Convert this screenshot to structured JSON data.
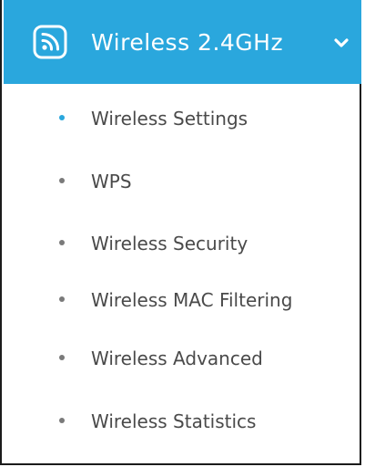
{
  "colors": {
    "accent": "#2aa7dd",
    "header_text": "#ffffff",
    "item_text": "#4a4a4a",
    "bullet": "#7a7a7a"
  },
  "menu": {
    "header": {
      "icon": "wireless-icon",
      "title": "Wireless 2.4GHz",
      "expand_icon": "chevron-down-icon"
    },
    "items": [
      {
        "label": "Wireless Settings",
        "active": true
      },
      {
        "label": "WPS",
        "active": false
      },
      {
        "label": "Wireless Security",
        "active": false
      },
      {
        "label": "Wireless MAC Filtering",
        "active": false
      },
      {
        "label": "Wireless Advanced",
        "active": false
      },
      {
        "label": "Wireless Statistics",
        "active": false
      }
    ]
  }
}
